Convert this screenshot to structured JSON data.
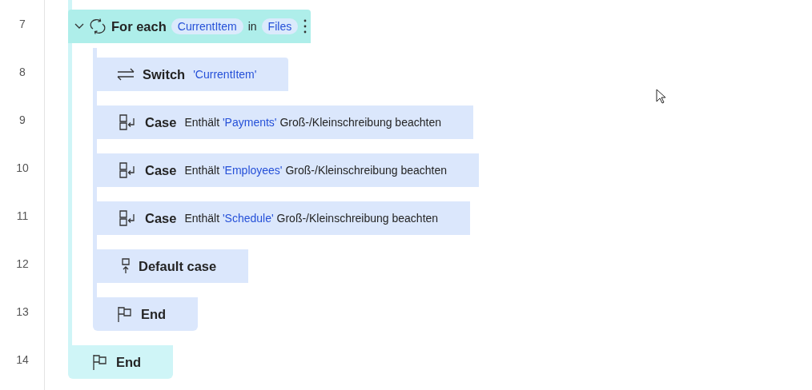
{
  "flow": [
    {
      "kind": "foreach",
      "line": "7",
      "keyword": "For each",
      "expanded": true,
      "item_variable": "CurrentItem",
      "connector": "in",
      "list_variable": "Files",
      "children": [
        {
          "kind": "switch",
          "line": "8",
          "keyword": "Switch",
          "value": "'CurrentItem'",
          "children": [
            {
              "kind": "case",
              "line": "9",
              "keyword": "Case",
              "operator": "Enthält",
              "value": "'Payments'",
              "option": "Groß-/Kleinschreibung beachten"
            },
            {
              "kind": "case",
              "line": "10",
              "keyword": "Case",
              "operator": "Enthält",
              "value": "'Employees'",
              "option": "Groß-/Kleinschreibung beachten"
            },
            {
              "kind": "case",
              "line": "11",
              "keyword": "Case",
              "operator": "Enthält",
              "value": "'Schedule'",
              "option": "Groß-/Kleinschreibung beachten"
            },
            {
              "kind": "default",
              "line": "12",
              "keyword": "Default case"
            },
            {
              "kind": "end",
              "line": "13",
              "keyword": "End"
            }
          ]
        },
        {
          "kind": "end",
          "line": "14",
          "keyword": "End"
        }
      ]
    }
  ]
}
